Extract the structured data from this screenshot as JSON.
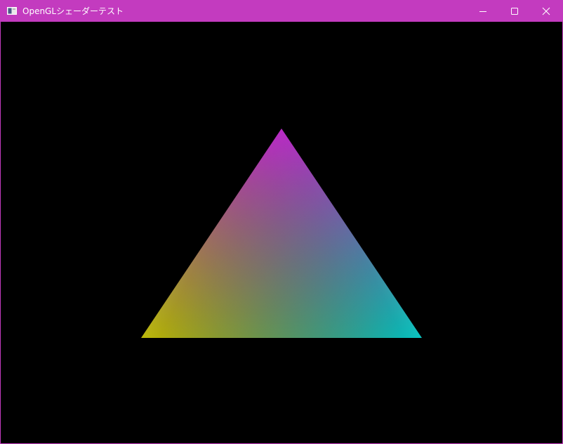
{
  "window": {
    "title": "OpenGLシェーダーテスト",
    "accent_color": "#c33bbf",
    "title_text_color": "#ffffff",
    "icons": {
      "app": "app-window-icon",
      "minimize": "minimize-icon",
      "maximize": "maximize-icon",
      "close": "close-icon"
    }
  },
  "canvas": {
    "background_color": "#000000",
    "triangle": {
      "vertex_colors": {
        "top": "#b611c4",
        "bottom_left": "#bdba0b",
        "bottom_right": "#0bc4c1"
      }
    }
  }
}
